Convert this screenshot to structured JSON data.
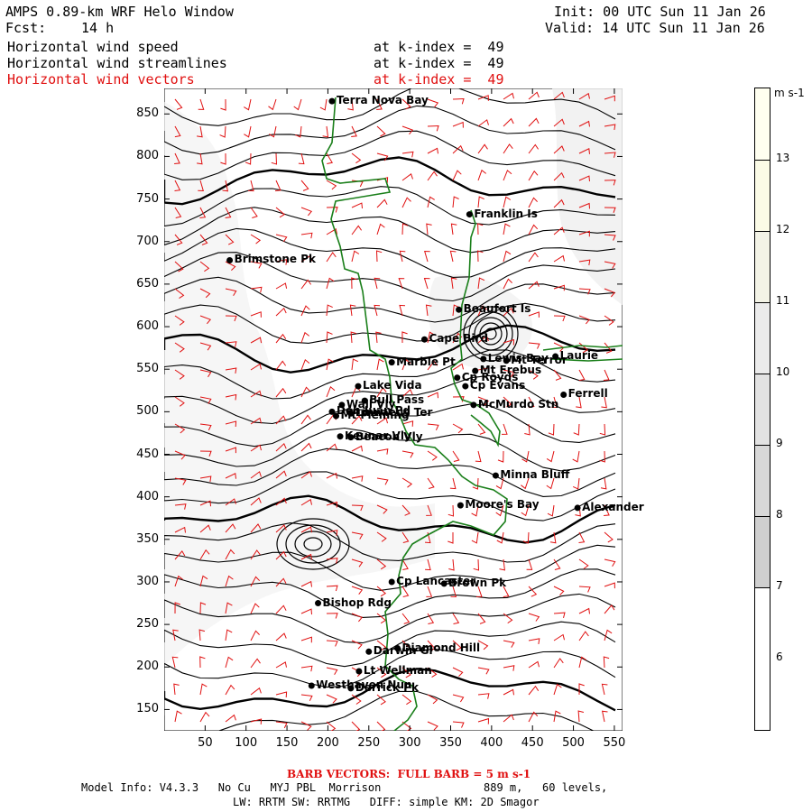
{
  "header": {
    "title": "AMPS 0.89-km WRF Helo Window",
    "fcst": "Fcst:",
    "fcst_hours": "14 h",
    "init": "Init: 00 UTC Sun 11 Jan 26",
    "valid": "Valid: 14 UTC Sun 11 Jan 26",
    "fields": [
      {
        "name": "Horizontal wind speed",
        "level": "at k-index =  49",
        "color": "#000000"
      },
      {
        "name": "Horizontal wind streamlines",
        "level": "at k-index =  49",
        "color": "#000000"
      },
      {
        "name": "Horizontal wind vectors",
        "level": "at k-index =  49",
        "color": "#e01010"
      }
    ]
  },
  "axes": {
    "x_ticks": [
      "50",
      "100",
      "150",
      "200",
      "250",
      "300",
      "350",
      "400",
      "450",
      "500",
      "550"
    ],
    "y_ticks": [
      "850",
      "800",
      "750",
      "700",
      "650",
      "600",
      "550",
      "500",
      "450",
      "400",
      "350",
      "300",
      "250",
      "200",
      "150"
    ],
    "xlim": [
      0,
      560
    ],
    "ylim": [
      125,
      880
    ]
  },
  "colorbar": {
    "unit": "m s-1",
    "labels": [
      "13",
      "12",
      "11",
      "10",
      "9",
      "8",
      "7",
      "6"
    ],
    "colors": [
      "#fffff0",
      "#fbfbe6",
      "#f3f3e6",
      "#ebebeb",
      "#e2e2e2",
      "#d8d8d8",
      "#cfcfcf",
      "#ffffff"
    ]
  },
  "places": [
    {
      "name": "Terra Nova Bay",
      "x": 205,
      "y": 865
    },
    {
      "name": "Franklin Is",
      "x": 373,
      "y": 732
    },
    {
      "name": "Brimstone Pk",
      "x": 80,
      "y": 678
    },
    {
      "name": "Beaufort Is",
      "x": 360,
      "y": 620
    },
    {
      "name": "Cape Bird",
      "x": 318,
      "y": 585
    },
    {
      "name": "Lewis Bay",
      "x": 390,
      "y": 562
    },
    {
      "name": "Mt Terror",
      "x": 418,
      "y": 560
    },
    {
      "name": "Laurie",
      "x": 478,
      "y": 565
    },
    {
      "name": "Marble Pt",
      "x": 278,
      "y": 558
    },
    {
      "name": "Cp Royds",
      "x": 358,
      "y": 540
    },
    {
      "name": "Mt Erebus",
      "x": 380,
      "y": 548
    },
    {
      "name": "Cp Evans",
      "x": 368,
      "y": 530
    },
    {
      "name": "Lake Vida",
      "x": 237,
      "y": 530
    },
    {
      "name": "Ferrell",
      "x": 488,
      "y": 520
    },
    {
      "name": "Bull Pass",
      "x": 245,
      "y": 513
    },
    {
      "name": "McMurdo Stn",
      "x": 378,
      "y": 508
    },
    {
      "name": "Wall Vly",
      "x": 217,
      "y": 508
    },
    {
      "name": "Don Juan Pd",
      "x": 205,
      "y": 500
    },
    {
      "name": "Linnaeus Ter",
      "x": 228,
      "y": 498
    },
    {
      "name": "Mt Fleming",
      "x": 210,
      "y": 495
    },
    {
      "name": "Keunar Vly",
      "x": 215,
      "y": 471
    },
    {
      "name": "Beacon Vly",
      "x": 228,
      "y": 470
    },
    {
      "name": "Minna Bluff",
      "x": 405,
      "y": 425
    },
    {
      "name": "Moore's Bay",
      "x": 362,
      "y": 390
    },
    {
      "name": "Alexander",
      "x": 505,
      "y": 387
    },
    {
      "name": "Cp Lancaster",
      "x": 278,
      "y": 300
    },
    {
      "name": "Brown Pk",
      "x": 342,
      "y": 298
    },
    {
      "name": "Bishop Rdg",
      "x": 188,
      "y": 275
    },
    {
      "name": "Darwin Gl",
      "x": 250,
      "y": 218
    },
    {
      "name": "Diamond Hill",
      "x": 285,
      "y": 222
    },
    {
      "name": "Lt Wellman",
      "x": 238,
      "y": 195
    },
    {
      "name": "Westhaven Nun",
      "x": 180,
      "y": 178
    },
    {
      "name": "Derrick Pk",
      "x": 228,
      "y": 175
    }
  ],
  "footer": {
    "barb": "BARB VECTORS:  FULL BARB = 5 m s-1",
    "model_info": "Model Info: V4.3.3   No Cu   MYJ PBL  Morrison",
    "model_res": "889 m,   60 levels,",
    "physics": "LW: RRTM SW: RRTMG   DIFF: simple KM: 2D Smagor"
  }
}
